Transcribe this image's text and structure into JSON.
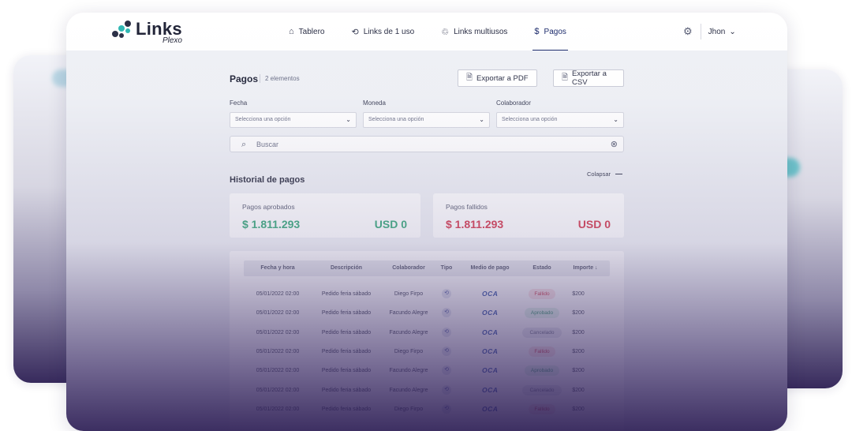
{
  "app": {
    "logo_main": "Links",
    "logo_sub": "Plexo"
  },
  "nav": {
    "items": [
      {
        "label": "Tablero",
        "icon": "home-icon"
      },
      {
        "label": "Links de 1 uso",
        "icon": "link-refresh-icon"
      },
      {
        "label": "Links multiusos",
        "icon": "recycle-icon"
      },
      {
        "label": "Pagos",
        "icon": "dollar-icon"
      }
    ],
    "active": "Pagos",
    "user": "Jhon"
  },
  "page": {
    "title": "Pagos",
    "count": "2 elementos",
    "export_pdf": "Exportar a PDF",
    "export_csv": "Exportar a CSV"
  },
  "filters": {
    "fecha": {
      "label": "Fecha",
      "placeholder": "Selecciona una opción"
    },
    "moneda": {
      "label": "Moneda",
      "placeholder": "Selecciona una opción"
    },
    "colaborador": {
      "label": "Colaborador",
      "placeholder": "Selecciona una opción"
    }
  },
  "search": {
    "placeholder": "Buscar"
  },
  "history": {
    "title": "Historial de pagos",
    "collapse": "Colapsar",
    "approved": {
      "label": "Pagos aprobados",
      "amount": "$ 1.811.293",
      "usd": "USD 0"
    },
    "failed": {
      "label": "Pagos fallidos",
      "amount": "$ 1.811.293",
      "usd": "USD 0"
    }
  },
  "table": {
    "columns": [
      "Fecha y hora",
      "Descripción",
      "Colaborador",
      "Tipo",
      "Medio de pago",
      "Estado",
      "Importe ↓"
    ],
    "rows": [
      {
        "fecha": "05/01/2022 02:00",
        "desc": "Pedido feria sábado",
        "colab": "Diego Firpo",
        "medio": "OCA",
        "estado": "Fallido",
        "importe": "$200"
      },
      {
        "fecha": "05/01/2022 02:00",
        "desc": "Pedido feria sábado",
        "colab": "Facundo Alegre",
        "medio": "OCA",
        "estado": "Aprobado",
        "importe": "$200"
      },
      {
        "fecha": "05/01/2022 02:00",
        "desc": "Pedido feria sábado",
        "colab": "Facundo Alegre",
        "medio": "OCA",
        "estado": "Cancelado",
        "importe": "$200"
      },
      {
        "fecha": "05/01/2022 02:00",
        "desc": "Pedido feria sábado",
        "colab": "Diego Firpo",
        "medio": "OCA",
        "estado": "Fallido",
        "importe": "$200"
      },
      {
        "fecha": "05/01/2022 02:00",
        "desc": "Pedido feria sábado",
        "colab": "Facundo Alegre",
        "medio": "OCA",
        "estado": "Aprobado",
        "importe": "$200"
      },
      {
        "fecha": "05/01/2022 02:00",
        "desc": "Pedido feria sábado",
        "colab": "Facundo Alegre",
        "medio": "OCA",
        "estado": "Cancelado",
        "importe": "$200"
      },
      {
        "fecha": "05/01/2022 02:00",
        "desc": "Pedido feria sábado",
        "colab": "Diego Firpo",
        "medio": "OCA",
        "estado": "Fallido",
        "importe": "$200"
      }
    ]
  },
  "colors": {
    "accent": "#1b2a6b",
    "approved": "#1f9e6a",
    "failed": "#d0223a",
    "teal": "#2fb8b3"
  }
}
